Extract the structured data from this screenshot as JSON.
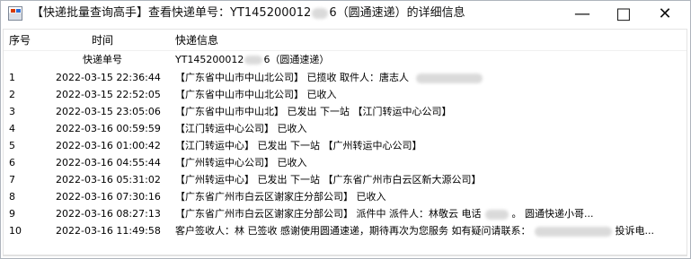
{
  "window": {
    "title_prefix": "【快递批量查询高手】查看快递单号：YT145200012",
    "title_suffix": "6（圆通速递）的详细信息",
    "minimize_glyph": "—",
    "maximize_glyph": "□",
    "close_glyph": "✕"
  },
  "table": {
    "headers": {
      "number": "序号",
      "time": "时间",
      "info": "快递信息"
    },
    "subheader": {
      "label": "快递单号",
      "tracking_prefix": "YT145200012",
      "tracking_suffix": "6（圆通速递）"
    },
    "rows": [
      {
        "number": "1",
        "time": "2022-03-15 22:36:44",
        "info": "【广东省中山市中山北公司】 已揽收 取件人：唐志人"
      },
      {
        "number": "2",
        "time": "2022-03-15 22:52:05",
        "info": "【广东省中山市中山北公司】 已收入"
      },
      {
        "number": "3",
        "time": "2022-03-15 23:05:06",
        "info": "【广东省中山市中山北】 已发出 下一站 【江门转运中心公司】"
      },
      {
        "number": "4",
        "time": "2022-03-16 00:59:59",
        "info": "【江门转运中心公司】 已收入"
      },
      {
        "number": "5",
        "time": "2022-03-16 01:00:42",
        "info": "【江门转运中心】 已发出 下一站 【广州转运中心公司】"
      },
      {
        "number": "6",
        "time": "2022-03-16 04:55:44",
        "info": "【广州转运中心公司】 已收入"
      },
      {
        "number": "7",
        "time": "2022-03-16 05:31:02",
        "info": "【广州转运中心】 已发出 下一站 【广东省广州市白云区新大源公司】"
      },
      {
        "number": "8",
        "time": "2022-03-16 07:30:16",
        "info": "【广东省广州市白云区谢家庄分部公司】 已收入"
      },
      {
        "number": "9",
        "time": "2022-03-16 08:27:13",
        "info_prefix": "【广东省广州市白云区谢家庄分部公司】 派件中  派件人：林敬云 电话",
        "info_suffix": "。 圆通快递小哥..."
      },
      {
        "number": "10",
        "time": "2022-03-16 11:49:58",
        "info_prefix": "客户签收人：林 已签收  感谢使用圆通速递，期待再次为您服务 如有疑问请联系：",
        "info_suffix": "投诉电..."
      }
    ]
  }
}
